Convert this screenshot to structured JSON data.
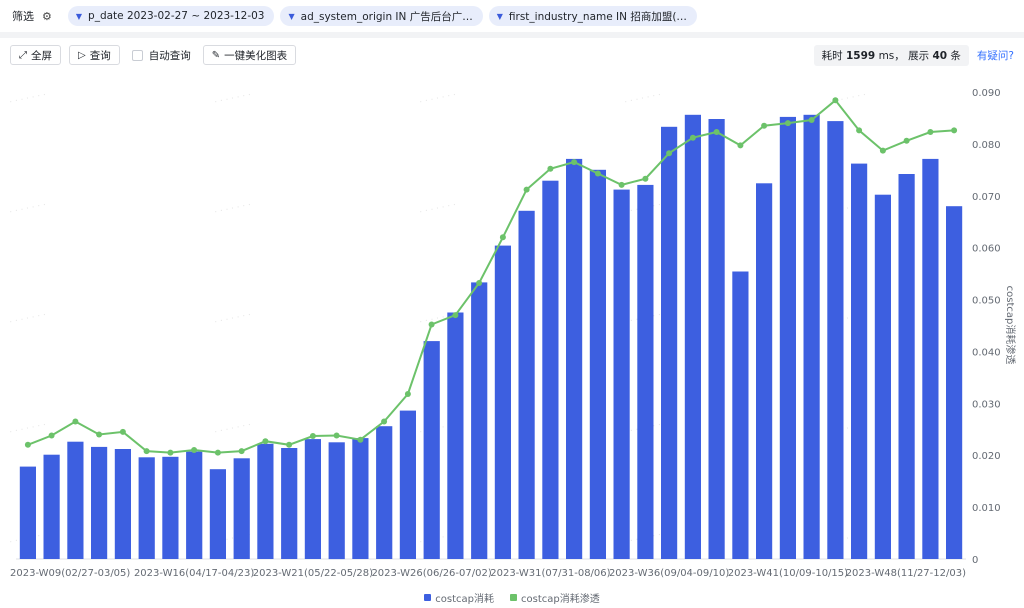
{
  "filters": {
    "label": "筛选",
    "chips": [
      "p_date 2023-02-27 ~ 2023-12-03",
      "ad_system_origin IN 广告后台广…",
      "first_industry_name IN 招商加盟(…"
    ]
  },
  "toolbar": {
    "fullscreen": "全屏",
    "query": "查询",
    "auto_query": "自动查询",
    "beautify": "一键美化图表"
  },
  "status": {
    "elapsed_prefix": "耗时",
    "elapsed_value": "1599",
    "elapsed_unit": "ms，",
    "shown_prefix": "展示",
    "shown_value": "40",
    "shown_unit": "条",
    "help": "有疑问?"
  },
  "colors": {
    "bar": "#3d5fe0",
    "line": "#6cc26a",
    "chip_bg": "#e8edfb",
    "link": "#3370ff"
  },
  "chart_data": {
    "type": "bar",
    "ylabel": "costcap消耗渗透",
    "ylim": [
      0,
      0.09
    ],
    "yticks": [
      "0",
      "0.010",
      "0.020",
      "0.030",
      "0.040",
      "0.050",
      "0.060",
      "0.070",
      "0.080",
      "0.090"
    ],
    "x_tick_labels": [
      {
        "index": 0,
        "label": "2023-W09(02/27-03/05)"
      },
      {
        "index": 7,
        "label": "2023-W16(04/17-04/23)"
      },
      {
        "index": 12,
        "label": "2023-W21(05/22-05/28)"
      },
      {
        "index": 17,
        "label": "2023-W26(06/26-07/02)"
      },
      {
        "index": 22,
        "label": "2023-W31(07/31-08/06)"
      },
      {
        "index": 27,
        "label": "2023-W36(09/04-09/10)"
      },
      {
        "index": 32,
        "label": "2023-W41(10/09-10/15)"
      },
      {
        "index": 39,
        "label": "2023-W48(11/27-12/03)"
      }
    ],
    "series": [
      {
        "name": "costcap消耗",
        "type": "bar",
        "values": [
          0.0178,
          0.0201,
          0.0226,
          0.0216,
          0.0212,
          0.0196,
          0.0197,
          0.0207,
          0.0173,
          0.0194,
          0.0222,
          0.0214,
          0.0231,
          0.0225,
          0.0233,
          0.0256,
          0.0286,
          0.042,
          0.0475,
          0.0533,
          0.0604,
          0.0671,
          0.0729,
          0.0771,
          0.075,
          0.0712,
          0.0721,
          0.0833,
          0.0856,
          0.0848,
          0.0554,
          0.0724,
          0.0852,
          0.0856,
          0.0844,
          0.0762,
          0.0702,
          0.0742,
          0.0771,
          0.068
        ]
      },
      {
        "name": "costcap消耗渗透",
        "type": "line",
        "values": [
          0.022,
          0.0238,
          0.0265,
          0.024,
          0.0245,
          0.0208,
          0.0205,
          0.021,
          0.0205,
          0.0208,
          0.0227,
          0.022,
          0.0237,
          0.0238,
          0.023,
          0.0265,
          0.0318,
          0.0452,
          0.047,
          0.0532,
          0.062,
          0.0712,
          0.0752,
          0.0765,
          0.0743,
          0.0721,
          0.0733,
          0.0782,
          0.0812,
          0.0823,
          0.0797,
          0.0835,
          0.084,
          0.0846,
          0.0884,
          0.0826,
          0.0787,
          0.0806,
          0.0823,
          0.0826
        ]
      }
    ]
  }
}
